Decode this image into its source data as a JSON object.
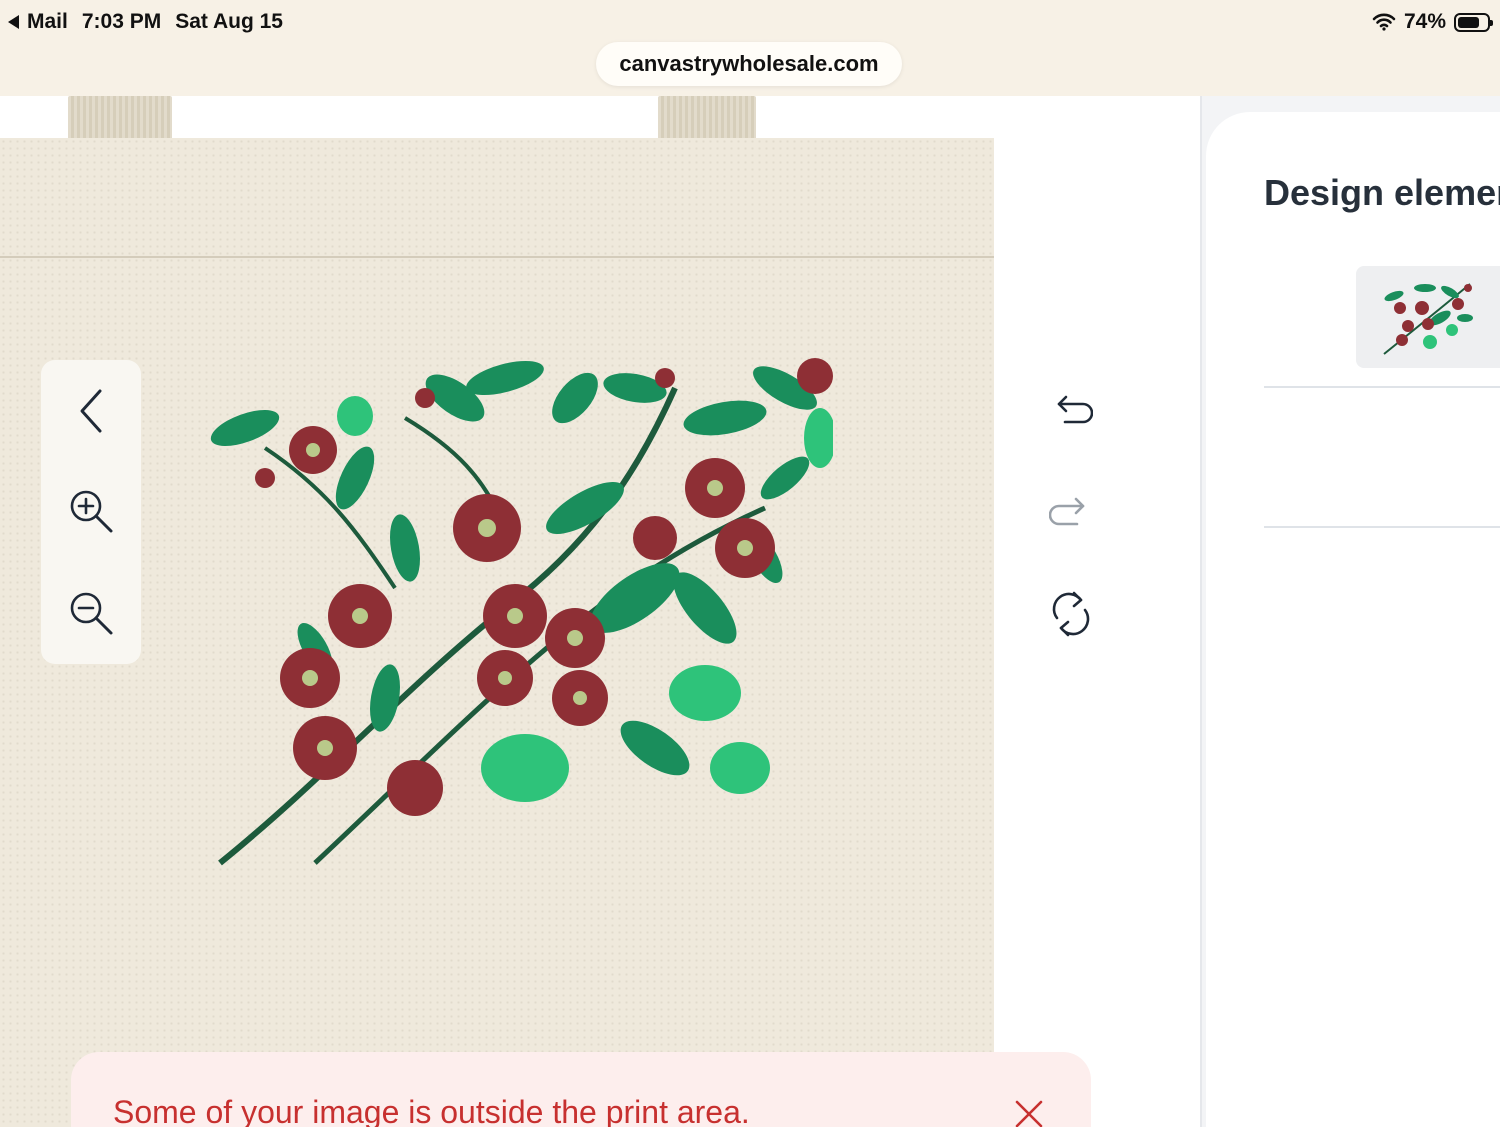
{
  "status_bar": {
    "back_app": "Mail",
    "time": "7:03 PM",
    "date": "Sat Aug 15",
    "battery": "74%"
  },
  "browser": {
    "url": "canvastrywholesale.com"
  },
  "toolbar": {
    "back_icon": "chevron-left-icon",
    "zoom_in_icon": "zoom-in-icon",
    "zoom_out_icon": "zoom-out-icon"
  },
  "actions": {
    "undo_icon": "undo-icon",
    "redo_icon": "redo-icon",
    "rotate_icon": "rotate-icon"
  },
  "side_panel": {
    "title": "Design elemen"
  },
  "toast": {
    "message": "Some of your image is outside the print area."
  },
  "colors": {
    "bag": "#efe9dc",
    "toast_bg": "#fdeeed",
    "toast_text": "#c7302f",
    "leaf": "#1a9a66",
    "flower": "#8e2f35"
  }
}
